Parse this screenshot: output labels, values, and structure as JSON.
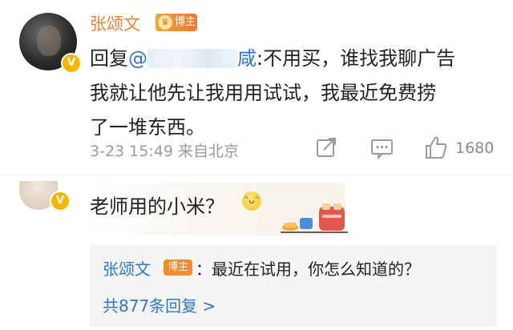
{
  "post": {
    "author": "张颂文",
    "author_badge": "博主",
    "reply_prefix": "回复",
    "mention_at": "@",
    "mention_visible": "咸",
    "text_line1": ":不用买，谁找我聊广告",
    "text_line2": "我就让他先让我用用试试，我最近免费捞",
    "text_line3": "了一堆东西。",
    "timestamp": "3-23 15:49",
    "source": "来自北京",
    "like_count": "1680",
    "icons": [
      "share-icon",
      "comment-icon",
      "like-icon"
    ]
  },
  "comment": {
    "text": "老师用的小米？"
  },
  "reply": {
    "author": "张颂文",
    "badge": "博主",
    "text": "：最近在试用，你怎么知道的？",
    "more": "共877条回复 >"
  },
  "colors": {
    "name_orange": "#e8833a",
    "link_blue": "#2e77c7",
    "badge_orange": "#f28a30",
    "vip_gold": "#f7b500"
  }
}
